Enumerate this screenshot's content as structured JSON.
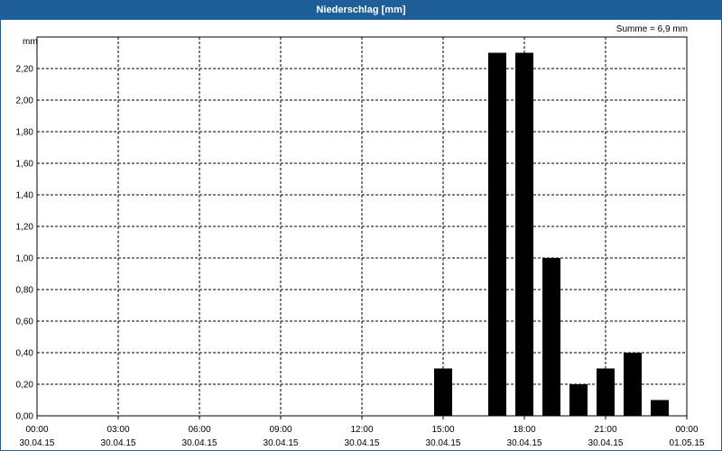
{
  "window": {
    "title": "Niederschlag [mm]"
  },
  "summary": "Summe = 6,9 mm",
  "chart_data": {
    "type": "bar",
    "title": "Niederschlag [mm]",
    "ylabel": "mm",
    "xlabel": "",
    "ylim": [
      0,
      2.4
    ],
    "xlim": [
      "30.04.15 00:00",
      "01.05.15 00:00"
    ],
    "grid": true,
    "y_ticks": [
      "0,00",
      "0,20",
      "0,40",
      "0,60",
      "0,80",
      "1,00",
      "1,20",
      "1,40",
      "1,60",
      "1,80",
      "2,00",
      "2,20"
    ],
    "x_ticks": [
      {
        "time": "00:00",
        "date": "30.04.15"
      },
      {
        "time": "03:00",
        "date": "30.04.15"
      },
      {
        "time": "06:00",
        "date": "30.04.15"
      },
      {
        "time": "09:00",
        "date": "30.04.15"
      },
      {
        "time": "12:00",
        "date": "30.04.15"
      },
      {
        "time": "15:00",
        "date": "30.04.15"
      },
      {
        "time": "18:00",
        "date": "30.04.15"
      },
      {
        "time": "21:00",
        "date": "30.04.15"
      },
      {
        "time": "00:00",
        "date": "01.05.15"
      }
    ],
    "x_hours": [
      15,
      17,
      18,
      19,
      20,
      21,
      22,
      23
    ],
    "values": [
      0.3,
      2.3,
      2.3,
      1.0,
      0.2,
      0.3,
      0.4,
      0.1
    ],
    "bar_color": "#000000"
  }
}
